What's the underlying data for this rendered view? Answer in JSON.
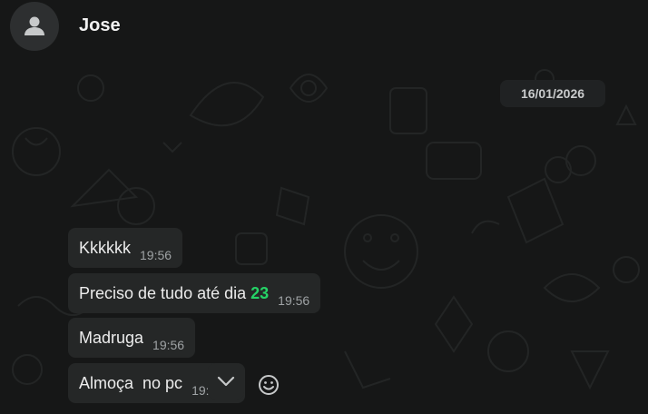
{
  "header": {
    "contact_name": "Jose",
    "avatar_icon": "user-icon"
  },
  "date_divider": "16/01/2026",
  "messages": [
    {
      "text": "Kkkkkk",
      "time": "19:56"
    },
    {
      "text_before": "Preciso de tudo até dia ",
      "highlight": "23",
      "time": "19:56"
    },
    {
      "text": "Madruga",
      "time": "19:56"
    },
    {
      "text": "Almoça  no pc",
      "time": "19:5"
    }
  ],
  "icons": {
    "scroll_down": "chevron-down-icon",
    "emoji": "emoji-icon"
  },
  "colors": {
    "background": "#161717",
    "bubble": "#252727",
    "accent": "#25d366"
  }
}
